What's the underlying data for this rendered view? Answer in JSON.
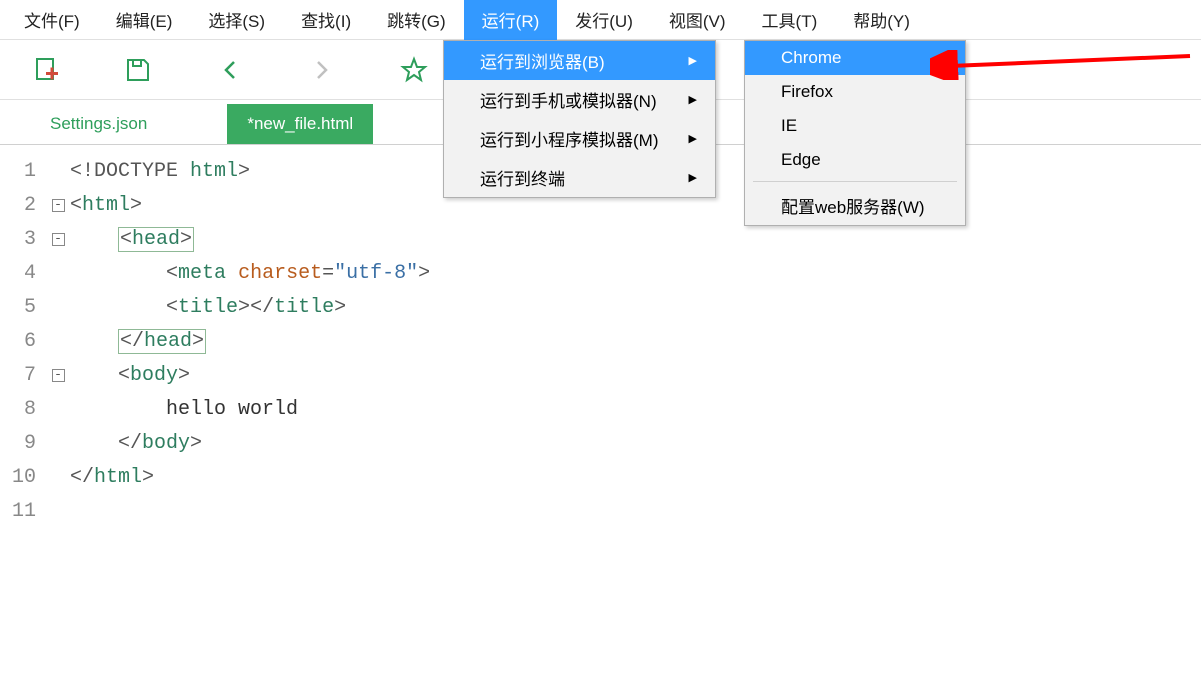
{
  "menubar": {
    "file": "文件(F)",
    "edit": "编辑(E)",
    "select": "选择(S)",
    "find": "查找(I)",
    "goto": "跳转(G)",
    "run": "运行(R)",
    "release": "发行(U)",
    "view": "视图(V)",
    "tools": "工具(T)",
    "help": "帮助(Y)"
  },
  "run_menu": {
    "to_browser": "运行到浏览器(B)",
    "to_phone": "运行到手机或模拟器(N)",
    "to_miniapp": "运行到小程序模拟器(M)",
    "to_terminal": "运行到终端"
  },
  "browser_submenu": {
    "chrome": "Chrome",
    "firefox": "Firefox",
    "ie": "IE",
    "edge": "Edge",
    "config": "配置web服务器(W)"
  },
  "tabs": {
    "settings": "Settings.json",
    "newfile": "*new_file.html"
  },
  "code": {
    "l1_a": "<!DOCTYPE ",
    "l1_b": "html",
    "l1_c": ">",
    "l2_a": "<",
    "l2_b": "html",
    "l2_c": ">",
    "l3_pad": "    ",
    "l3_a": "<",
    "l3_b": "head",
    "l3_c": ">",
    "l4_pad": "        ",
    "l4_a": "<",
    "l4_b": "meta",
    "l4_sp": " ",
    "l4_attr": "charset",
    "l4_eq": "=",
    "l4_str": "\"utf-8\"",
    "l4_c": ">",
    "l5_pad": "        ",
    "l5_a": "<",
    "l5_b": "title",
    "l5_c": ">",
    "l5_d": "</",
    "l5_e": "title",
    "l5_f": ">",
    "l6_pad": "    ",
    "l6_a": "</",
    "l6_b": "head",
    "l6_c": ">",
    "l7_pad": "    ",
    "l7_a": "<",
    "l7_b": "body",
    "l7_c": ">",
    "l8_pad": "        ",
    "l8_text": "hello world",
    "l9_pad": "    ",
    "l9_a": "</",
    "l9_b": "body",
    "l9_c": ">",
    "l10_a": "</",
    "l10_b": "html",
    "l10_c": ">"
  },
  "line_numbers": [
    "1",
    "2",
    "3",
    "4",
    "5",
    "6",
    "7",
    "8",
    "9",
    "10",
    "11"
  ]
}
